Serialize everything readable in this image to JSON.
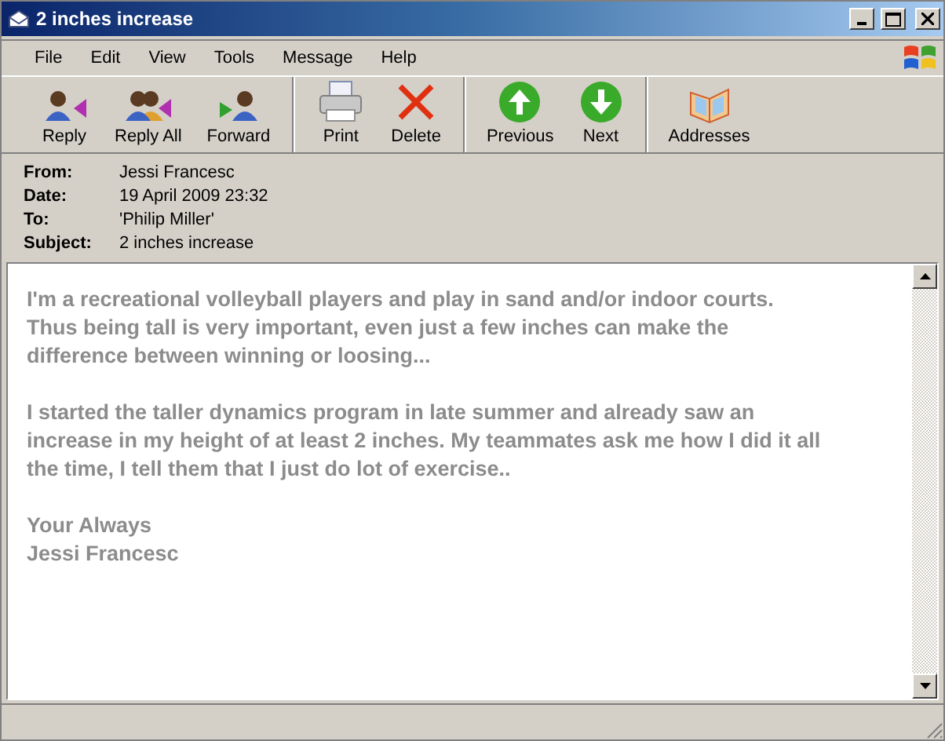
{
  "window": {
    "title": "2 inches increase"
  },
  "menu": [
    "File",
    "Edit",
    "View",
    "Tools",
    "Message",
    "Help"
  ],
  "toolbar": [
    [
      {
        "label": "Reply",
        "kind": "reply"
      },
      {
        "label": "Reply All",
        "kind": "replyall"
      },
      {
        "label": "Forward",
        "kind": "forward"
      }
    ],
    [
      {
        "label": "Print",
        "kind": "print"
      },
      {
        "label": "Delete",
        "kind": "delete"
      }
    ],
    [
      {
        "label": "Previous",
        "kind": "previous"
      },
      {
        "label": "Next",
        "kind": "next"
      }
    ],
    [
      {
        "label": "Addresses",
        "kind": "addresses"
      }
    ]
  ],
  "headers": [
    {
      "label": "From:",
      "value": "Jessi Francesc"
    },
    {
      "label": "Date:",
      "value": "19 April 2009 23:32"
    },
    {
      "label": "To:",
      "value": "'Philip Miller'"
    },
    {
      "label": "Subject:",
      "value": "2 inches increase"
    }
  ],
  "body": [
    [
      "I'm a recreational volleyball players and play in sand and/or indoor courts.",
      "Thus being tall is very important, even just a few inches can make the",
      "difference between winning or loosing..."
    ],
    [
      "I started the taller dynamics program in late summer and already saw an",
      "increase in my height of at least 2 inches. My teammates ask me how I did it all",
      "the time, I tell them that I just do lot of exercise.."
    ],
    [
      "Your Always",
      "Jessi Francesc"
    ]
  ]
}
